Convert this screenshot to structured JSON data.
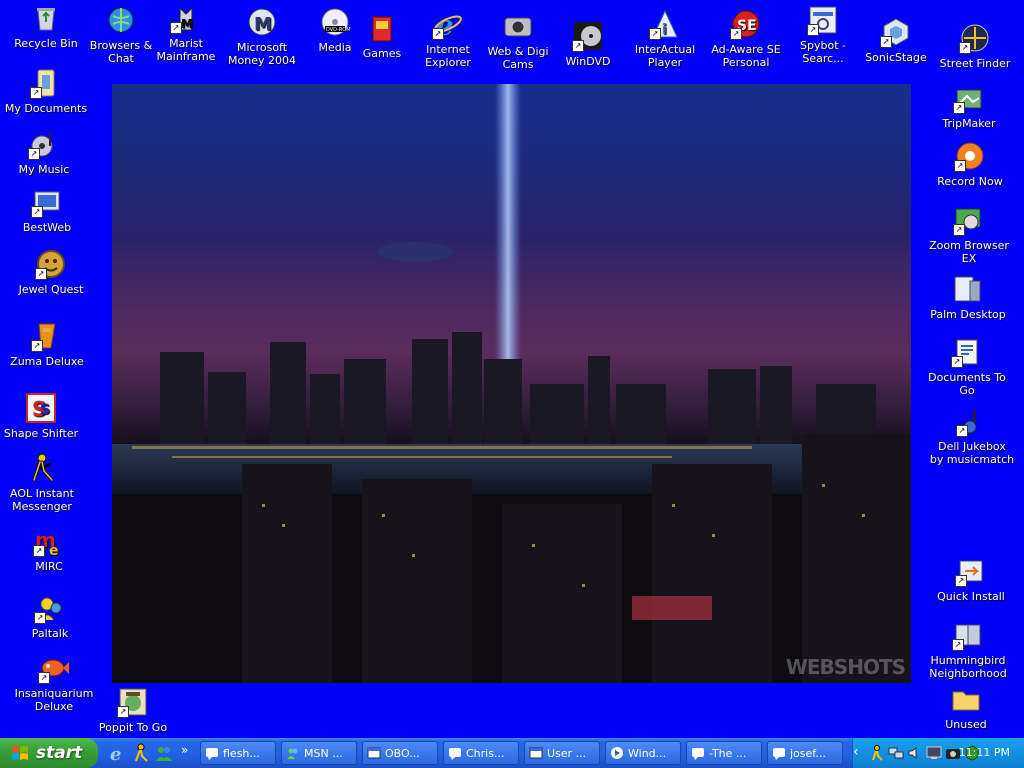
{
  "wallpaper": {
    "watermark": "WEBSHOTS"
  },
  "desktop_icons_left": [
    {
      "label": "Recycle Bin",
      "icon": "recycle-bin-icon"
    },
    {
      "label": "My Documents",
      "icon": "my-documents-icon"
    },
    {
      "label": "My Music",
      "icon": "my-music-icon"
    },
    {
      "label": "BestWeb",
      "icon": "bestweb-icon"
    },
    {
      "label": "Jewel Quest",
      "icon": "jewel-quest-icon"
    },
    {
      "label": "Zuma Deluxe",
      "icon": "zuma-deluxe-icon"
    },
    {
      "label": "Shape Shifter",
      "icon": "shape-shifter-icon"
    },
    {
      "label": "AOL Instant\nMessenger",
      "icon": "aim-icon"
    },
    {
      "label": "MIRC",
      "icon": "mirc-icon"
    },
    {
      "label": "Paltalk",
      "icon": "paltalk-icon"
    },
    {
      "label": "Insaniquarium\nDeluxe",
      "icon": "insaniquarium-icon"
    }
  ],
  "desktop_icons_top": [
    {
      "label": "Browsers &\nChat",
      "icon": "browsers-chat-icon"
    },
    {
      "label": "Marist\nMainframe",
      "icon": "marist-mainframe-icon"
    },
    {
      "label": "Microsoft\nMoney 2004",
      "icon": "ms-money-icon"
    },
    {
      "label": "Media",
      "icon": "media-dvd-icon"
    },
    {
      "label": "Games",
      "icon": "games-folder-icon"
    },
    {
      "label": "Internet\nExplorer",
      "icon": "internet-explorer-icon"
    },
    {
      "label": "Web & Digi\nCams",
      "icon": "webcam-icon"
    },
    {
      "label": "WinDVD",
      "icon": "windvd-icon"
    },
    {
      "label": "InterActual\nPlayer",
      "icon": "interactual-player-icon"
    },
    {
      "label": "Ad-Aware SE\nPersonal",
      "icon": "ad-aware-icon"
    },
    {
      "label": "Spybot -\nSearc...",
      "icon": "spybot-icon"
    },
    {
      "label": "SonicStage",
      "icon": "sonicstage-icon"
    }
  ],
  "desktop_icons_right": [
    {
      "label": "Street Finder",
      "icon": "street-finder-icon"
    },
    {
      "label": "TripMaker",
      "icon": "tripmaker-icon"
    },
    {
      "label": "Record Now",
      "icon": "record-now-icon"
    },
    {
      "label": "Zoom Browser\nEX",
      "icon": "zoom-browser-icon"
    },
    {
      "label": "Palm Desktop",
      "icon": "palm-desktop-icon"
    },
    {
      "label": "Documents To\nGo",
      "icon": "documents-to-go-icon"
    },
    {
      "label": "Dell Jukebox\nby musicmatch",
      "icon": "dell-jukebox-icon"
    },
    {
      "label": "Quick Install",
      "icon": "quick-install-icon"
    },
    {
      "label": "Hummingbird\nNeighborhood",
      "icon": "hummingbird-icon"
    },
    {
      "label": "Unused",
      "icon": "folder-icon"
    }
  ],
  "desktop_icons_bottom": [
    {
      "label": "Poppit To Go",
      "icon": "poppit-icon"
    }
  ],
  "taskbar": {
    "start_label": "start",
    "quick_launch": [
      "internet-explorer-icon",
      "aim-icon",
      "msn-icon"
    ],
    "tasks": [
      {
        "label": "flesh...",
        "icon": "aim-chat-icon"
      },
      {
        "label": "MSN ...",
        "icon": "msn-icon"
      },
      {
        "label": "OBO...",
        "icon": "window-icon"
      },
      {
        "label": "Chris...",
        "icon": "aim-chat-icon"
      },
      {
        "label": "User ...",
        "icon": "window-icon"
      },
      {
        "label": "Wind...",
        "icon": "media-player-icon"
      },
      {
        "label": "-The ...",
        "icon": "aim-chat-icon"
      },
      {
        "label": "josef...",
        "icon": "aim-chat-icon"
      }
    ],
    "tray_icons": [
      "aim-tray-icon",
      "network-tray-icon",
      "volume-tray-icon",
      "display-tray-icon",
      "camera-tray-icon",
      "security-tray-icon"
    ],
    "clock": "11:11 PM"
  }
}
